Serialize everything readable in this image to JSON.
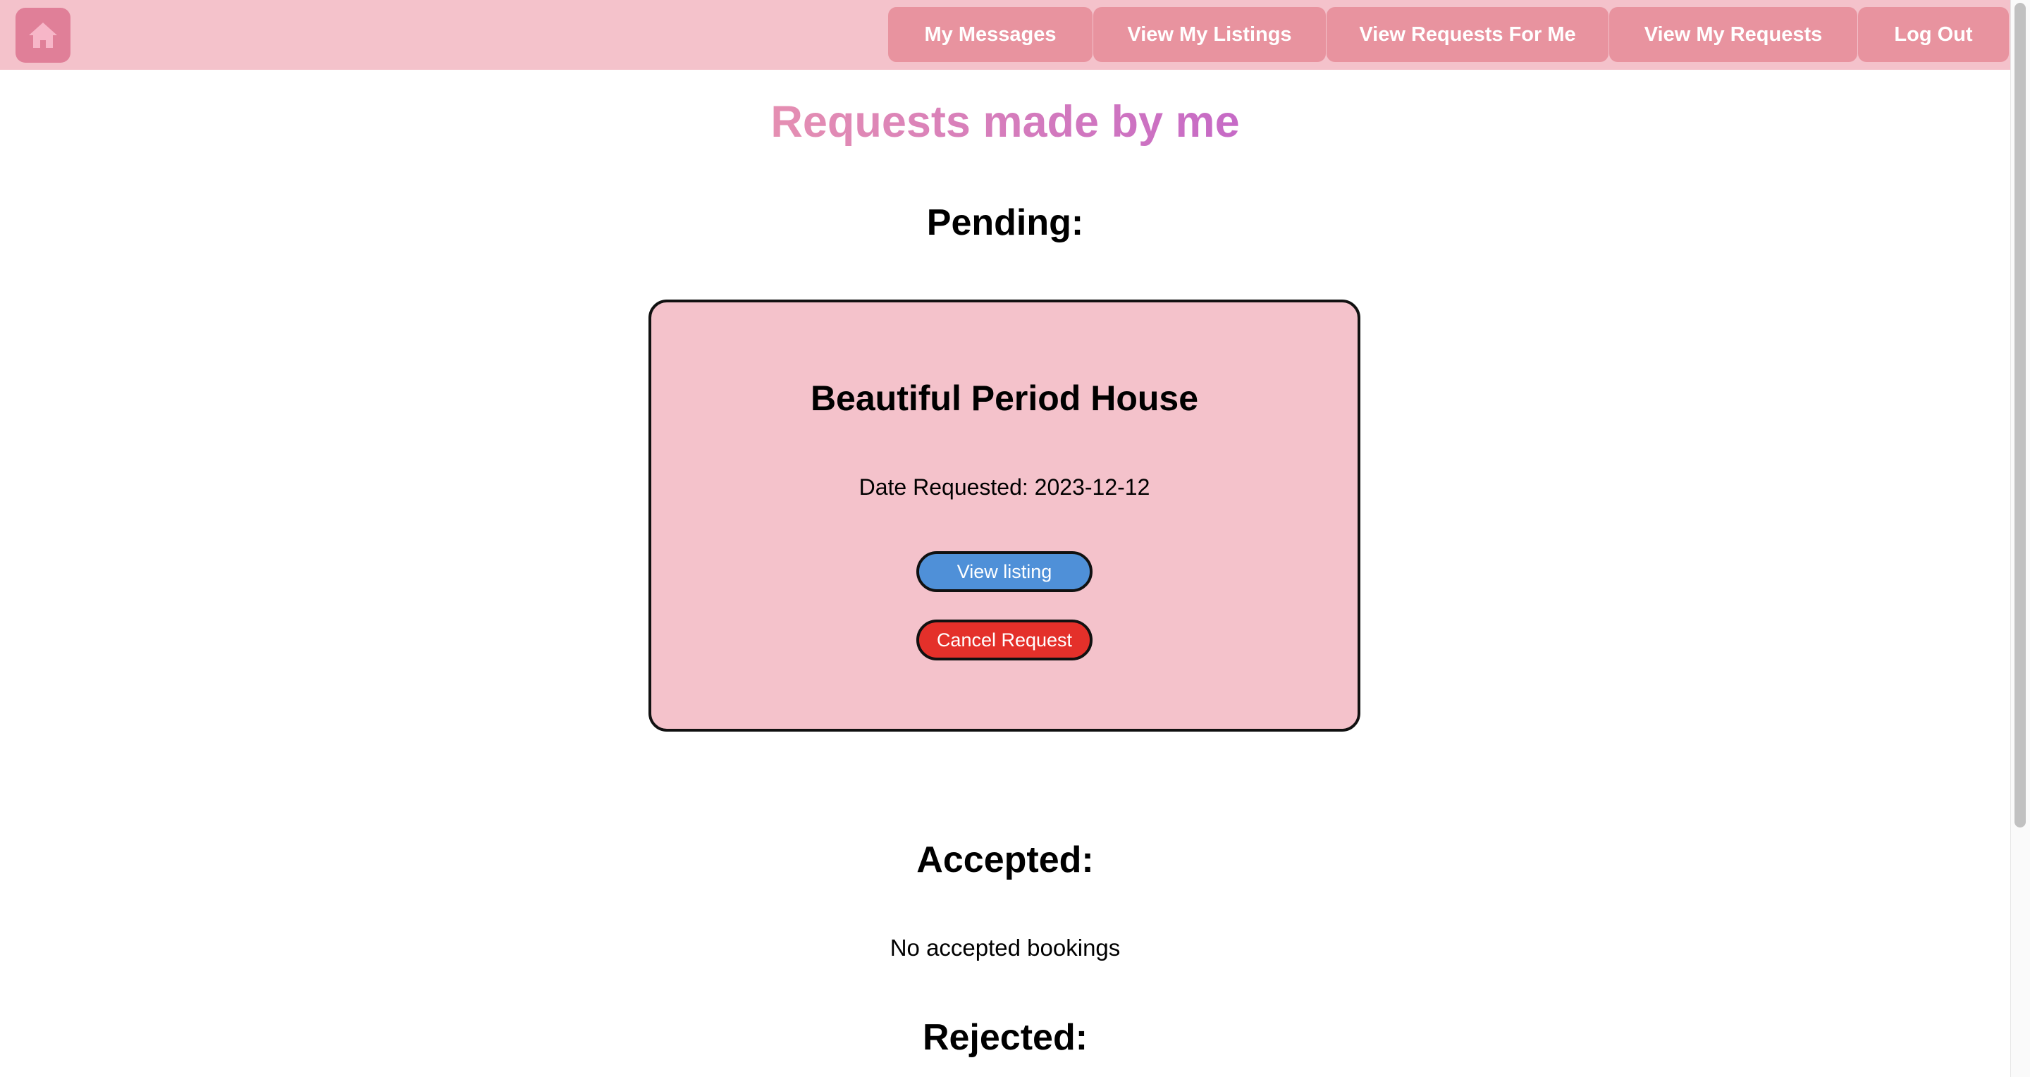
{
  "navbar": {
    "home_icon": "home-icon",
    "items": [
      {
        "label": "My Messages"
      },
      {
        "label": "View My Listings"
      },
      {
        "label": "View Requests For Me"
      },
      {
        "label": "View My Requests"
      },
      {
        "label": "Log Out"
      }
    ],
    "colors": {
      "bar": "#f4c2cb",
      "button": "#e8939f",
      "home_button": "#e07f98"
    }
  },
  "page": {
    "title": "Requests made by me",
    "title_gradient": [
      "#e58fb2",
      "#c66ac6"
    ]
  },
  "sections": {
    "pending": {
      "heading": "Pending:",
      "requests": [
        {
          "title": "Beautiful Period House",
          "date_label": "Date Requested:",
          "date": "2023-12-12",
          "view_button": "View listing",
          "cancel_button": "Cancel Request"
        }
      ]
    },
    "accepted": {
      "heading": "Accepted:",
      "empty_message": "No accepted bookings"
    },
    "rejected": {
      "heading": "Rejected:"
    }
  },
  "colors": {
    "card_background": "#f4c2cb",
    "view_button": "#4f90d8",
    "cancel_button": "#e4302a"
  }
}
